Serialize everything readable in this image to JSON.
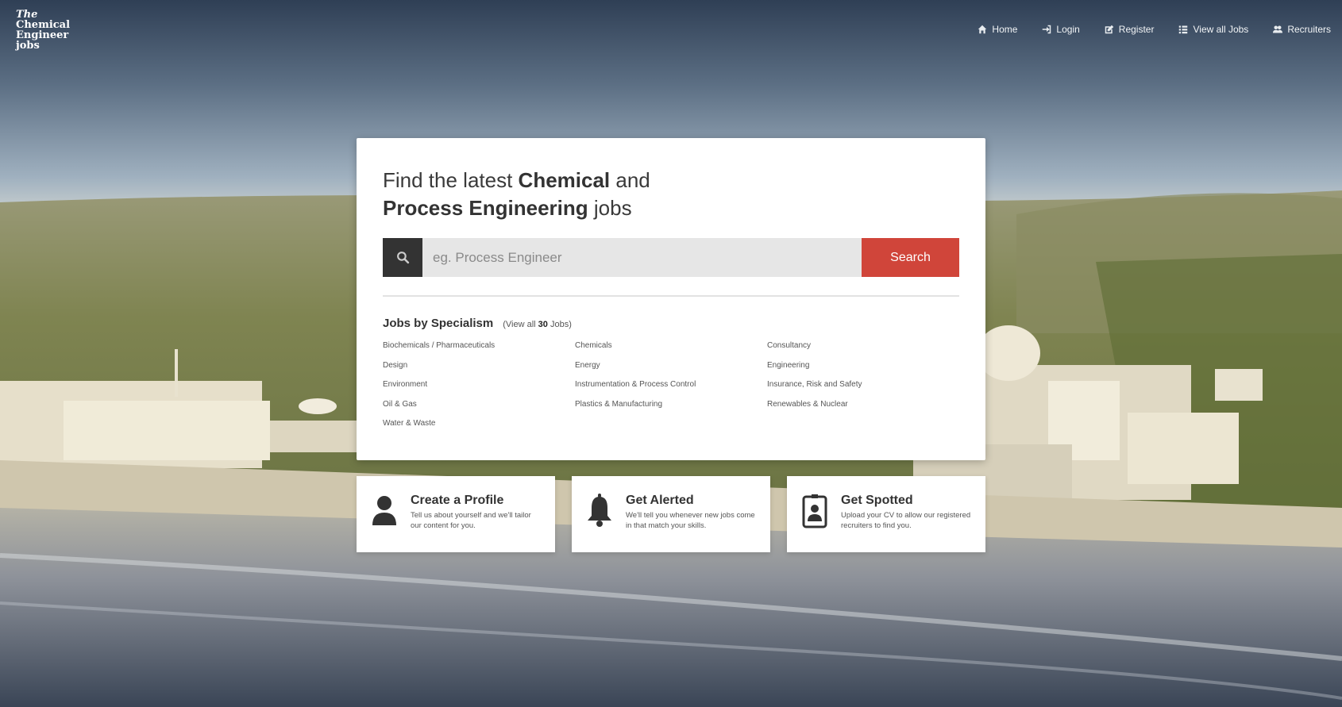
{
  "brand": {
    "logo_line1": "The",
    "logo_line2": "Chemical",
    "logo_line3": "Engineer",
    "logo_line4": "jobs"
  },
  "nav": {
    "home": "Home",
    "login": "Login",
    "register": "Register",
    "view_all_jobs": "View all Jobs",
    "recruiters": "Recruiters"
  },
  "hero": {
    "headline_part1": "Find the latest ",
    "headline_bold1": "Chemical",
    "headline_part2": " and",
    "headline_bold2": "Process Engineering",
    "headline_part3": " jobs"
  },
  "search": {
    "placeholder": "eg. Process Engineer",
    "button_label": "Search"
  },
  "specialisms": {
    "title": "Jobs by Specialism",
    "view_all_prefix": "(View all ",
    "view_all_count": "30",
    "view_all_suffix": " Jobs)",
    "items": [
      "Biochemicals / Pharmaceuticals",
      "Chemicals",
      "Consultancy",
      "Design",
      "Energy",
      "Engineering",
      "Environment",
      "Instrumentation & Process Control",
      "Insurance, Risk and Safety",
      "Oil & Gas",
      "Plastics & Manufacturing",
      "Renewables & Nuclear",
      "Water & Waste"
    ]
  },
  "features": [
    {
      "icon": "user-icon",
      "title": "Create a Profile",
      "text": "Tell us about yourself and we'll tailor our content for you."
    },
    {
      "icon": "bell-icon",
      "title": "Get Alerted",
      "text": "We'll tell you whenever new jobs come in that match your skills."
    },
    {
      "icon": "id-badge-icon",
      "title": "Get Spotted",
      "text": "Upload your CV to allow our registered recruiters to find you."
    }
  ],
  "colors": {
    "accent": "#d0453a",
    "dark": "#333333",
    "input_bg": "#e6e6e6"
  }
}
